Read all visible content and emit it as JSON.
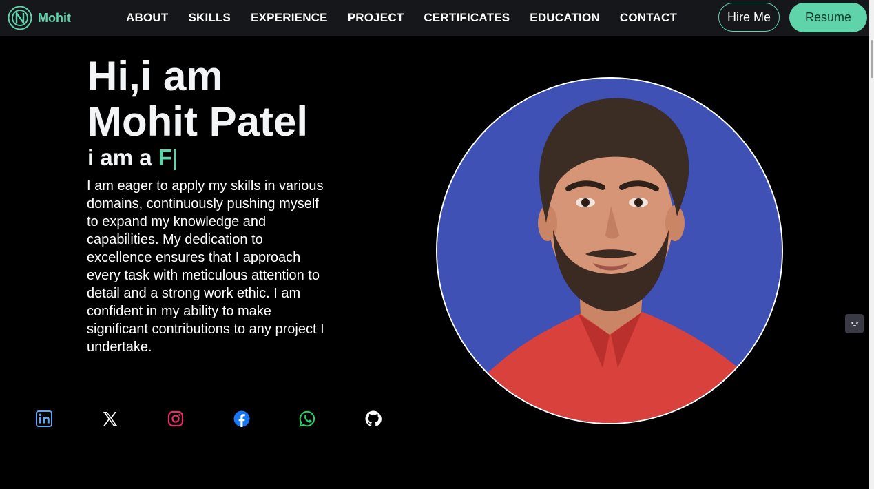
{
  "brand": {
    "name": "Mohit",
    "logo_icon": "brand-logo-icon",
    "accent_color": "#5fd3a9"
  },
  "nav": {
    "links": [
      "ABOUT",
      "SKILLS",
      "EXPERIENCE",
      "PROJECT",
      "CERTIFICATES",
      "EDUCATION",
      "CONTACT"
    ],
    "hire_label": "Hire Me",
    "resume_label": "Resume"
  },
  "hero": {
    "title_line1": "Hi,i am",
    "title_line2": "Mohit Patel",
    "typing_prefix": "i am a ",
    "typing_text": "F",
    "typing_cursor": "|",
    "bio": "I am eager to apply my skills in various domains, continuously pushing myself to expand my knowledge and capabilities. My dedication to excellence ensures that I approach every task with meticulous attention to detail and a strong work ethic. I am confident in my ability to make significant contributions to any project I undertake."
  },
  "social": [
    {
      "icon": "linkedin-icon",
      "color": "#6aa3f0"
    },
    {
      "icon": "x-twitter-icon",
      "color": "#ffffff"
    },
    {
      "icon": "instagram-icon",
      "color": "#e1306c"
    },
    {
      "icon": "facebook-icon",
      "color": "#1877f2"
    },
    {
      "icon": "whatsapp-icon",
      "color": "#25d366"
    },
    {
      "icon": "github-icon",
      "color": "#ffffff"
    }
  ],
  "portrait": {
    "background_color": "#3f51b5",
    "border_color": "#ffffff"
  },
  "widget": {
    "icon": "terminal-face-icon"
  }
}
